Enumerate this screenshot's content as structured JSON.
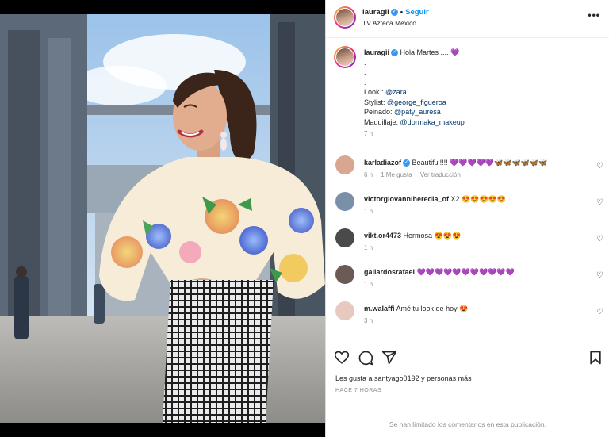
{
  "header": {
    "username": "lauragii",
    "follow_label": "Seguir",
    "location": "TV Azteca México"
  },
  "caption": {
    "username": "lauragii",
    "greeting": "Hola Martes ....",
    "greeting_emoji": "💜",
    "dot_lines": [
      ".",
      ".",
      "."
    ],
    "look_label": "Look :",
    "look_value": "@zara",
    "stylist_label": "Stylist:",
    "stylist_value": "@george_figueroa",
    "peinado_label": "Peinado:",
    "peinado_value": "@paty_auresa",
    "maquillaje_label": "Maquillaje:",
    "maquillaje_value": "@dormaka_makeup",
    "time": "7 h"
  },
  "comments": [
    {
      "username": "karladiazof",
      "verified": true,
      "text": "Beautiful!!!! 💜💜💜💜💜🦋🦋🦋🦋🦋🦋",
      "time": "6 h",
      "likes": "1 Me gusta",
      "translate": "Ver traducción",
      "avatar_color": "#d9a78f"
    },
    {
      "username": "victorgiovanniheredia_of",
      "verified": false,
      "text": "X2 😍😍😍😍😍",
      "time": "1 h",
      "avatar_color": "#7a8fa8"
    },
    {
      "username": "vikt.or4473",
      "verified": false,
      "text": "Hermosa 😍😍😍",
      "time": "1 h",
      "avatar_color": "#4a4a4a"
    },
    {
      "username": "gallardosrafael",
      "verified": false,
      "text": "💜💜💜💜💜💜💜💜💜💜💜",
      "time": "1 h",
      "avatar_color": "#6b5a55"
    },
    {
      "username": "m.walaffi",
      "verified": false,
      "text": "Amé tu look de hoy 😍",
      "time": "3 h",
      "avatar_color": "#e8c9c0"
    }
  ],
  "likes_text": "Les gusta a santyago0192 y personas más",
  "time_ago": "HACE 7 HORAS",
  "footer": "Se han limitado los comentarios en esta publicación.",
  "icons": {
    "heart": "heart-icon",
    "comment": "comment-icon",
    "share": "share-icon",
    "save": "bookmark-icon",
    "more": "more-options-icon",
    "verified": "verified-badge-icon"
  },
  "colors": {
    "accent": "#0095f6",
    "verified": "#3897f0",
    "muted": "#8e8e8e",
    "link": "#00376b"
  }
}
